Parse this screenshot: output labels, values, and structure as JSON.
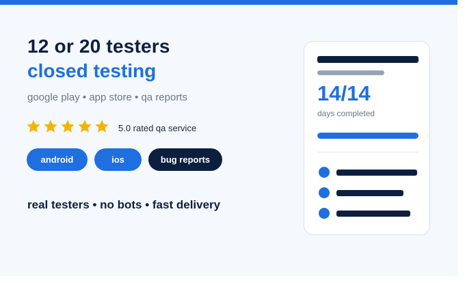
{
  "hero": {
    "headline": "12 or 20 testers",
    "subheadline": "closed testing",
    "platforms": "google play • app store • qa reports",
    "rating": {
      "stars": 5,
      "text": "5.0 rated qa service"
    },
    "tags": [
      {
        "label": "android",
        "style": "blue"
      },
      {
        "label": "ios",
        "style": "blue"
      },
      {
        "label": "bug reports",
        "style": "dark"
      }
    ],
    "tagline": "real testers • no bots • fast delivery"
  },
  "card": {
    "count": "14/14",
    "caption": "days completed",
    "progress": 1.0
  },
  "colors": {
    "accent": "#1f6fe0",
    "dark": "#0d1f3f",
    "star": "#f4b400",
    "muted": "#6b778a",
    "background": "#f5f8fd"
  }
}
